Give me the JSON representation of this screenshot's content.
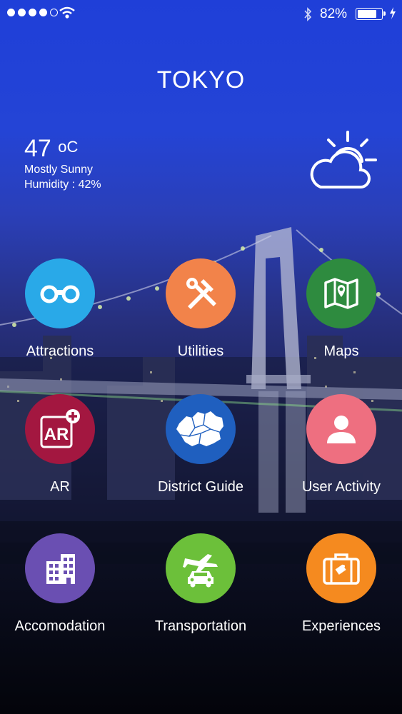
{
  "status_bar": {
    "battery_percent": "82%",
    "battery_level": 0.82,
    "signal_bars_filled": 4,
    "signal_bars_total": 5
  },
  "header": {
    "city": "TOKYO"
  },
  "weather": {
    "temperature": "47",
    "unit": "oC",
    "condition": "Mostly Sunny",
    "humidity": "Humidity : 42%",
    "icon": "partly-cloudy-icon"
  },
  "menu": [
    {
      "label": "Attractions",
      "color": "#29a9e8",
      "icon": "binoculars-icon"
    },
    {
      "label": "Utilities",
      "color": "#f2834a",
      "icon": "tools-icon"
    },
    {
      "label": "Maps",
      "color": "#2e8b3f",
      "icon": "map-icon"
    },
    {
      "label": "AR",
      "color": "#a31740",
      "icon": "ar-icon"
    },
    {
      "label": "District Guide",
      "color": "#1f5fbf",
      "icon": "district-map-icon"
    },
    {
      "label": "User Activity",
      "color": "#ee6f80",
      "icon": "user-icon"
    },
    {
      "label": "Accomodation",
      "color": "#6a4fb2",
      "icon": "building-icon"
    },
    {
      "label": "Transportation",
      "color": "#6cc03a",
      "icon": "transport-icon"
    },
    {
      "label": "Experiences",
      "color": "#f58a1f",
      "icon": "suitcase-icon"
    }
  ]
}
